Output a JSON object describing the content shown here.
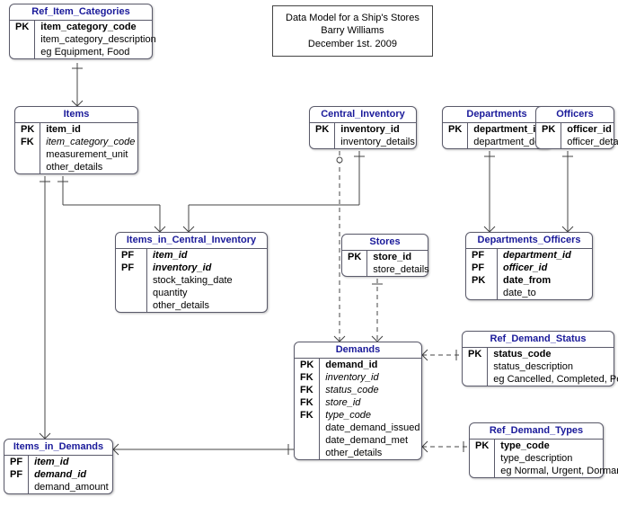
{
  "title": {
    "line1": "Data Model for a Ship's Stores",
    "line2": "Barry Williams",
    "line3": "December 1st. 2009"
  },
  "entities": {
    "ref_item_categories": {
      "name": "Ref_Item_Categories",
      "rows": [
        {
          "key": "PK",
          "attr": "item_category_code",
          "cls": "pk"
        },
        {
          "key": "",
          "attr": "item_category_description",
          "cls": ""
        },
        {
          "key": "",
          "attr": "eg Equipment, Food",
          "cls": "note"
        }
      ]
    },
    "items": {
      "name": "Items",
      "rows": [
        {
          "key": "PK",
          "attr": "item_id",
          "cls": "pk"
        },
        {
          "key": "FK",
          "attr": "item_category_code",
          "cls": "fk"
        },
        {
          "key": "",
          "attr": "measurement_unit",
          "cls": ""
        },
        {
          "key": "",
          "attr": "other_details",
          "cls": ""
        }
      ]
    },
    "central_inventory": {
      "name": "Central_Inventory",
      "rows": [
        {
          "key": "PK",
          "attr": "inventory_id",
          "cls": "pk"
        },
        {
          "key": "",
          "attr": "inventory_details",
          "cls": ""
        }
      ]
    },
    "departments": {
      "name": "Departments",
      "rows": [
        {
          "key": "PK",
          "attr": "department_id",
          "cls": "pk"
        },
        {
          "key": "",
          "attr": "department_details",
          "cls": ""
        }
      ]
    },
    "officers": {
      "name": "Officers",
      "rows": [
        {
          "key": "PK",
          "attr": "officer_id",
          "cls": "pk"
        },
        {
          "key": "",
          "attr": "officer_details",
          "cls": ""
        }
      ]
    },
    "items_in_central_inventory": {
      "name": "Items_in_Central_Inventory",
      "rows": [
        {
          "key": "PF",
          "attr": "item_id",
          "cls": "pf"
        },
        {
          "key": "PF",
          "attr": "inventory_id",
          "cls": "pf"
        },
        {
          "key": "",
          "attr": "stock_taking_date",
          "cls": ""
        },
        {
          "key": "",
          "attr": "quantity",
          "cls": ""
        },
        {
          "key": "",
          "attr": "other_details",
          "cls": ""
        }
      ]
    },
    "stores": {
      "name": "Stores",
      "rows": [
        {
          "key": "PK",
          "attr": "store_id",
          "cls": "pk"
        },
        {
          "key": "",
          "attr": "store_details",
          "cls": ""
        }
      ]
    },
    "departments_officers": {
      "name": "Departments_Officers",
      "rows": [
        {
          "key": "PF",
          "attr": "department_id",
          "cls": "pf"
        },
        {
          "key": "PF",
          "attr": "officer_id",
          "cls": "pf"
        },
        {
          "key": "PK",
          "attr": "date_from",
          "cls": "pk"
        },
        {
          "key": "",
          "attr": "date_to",
          "cls": ""
        }
      ]
    },
    "demands": {
      "name": "Demands",
      "rows": [
        {
          "key": "PK",
          "attr": "demand_id",
          "cls": "pk"
        },
        {
          "key": "FK",
          "attr": "inventory_id",
          "cls": "fk"
        },
        {
          "key": "FK",
          "attr": "status_code",
          "cls": "fk"
        },
        {
          "key": "FK",
          "attr": "store_id",
          "cls": "fk"
        },
        {
          "key": "FK",
          "attr": "type_code",
          "cls": "fk"
        },
        {
          "key": "",
          "attr": "date_demand_issued",
          "cls": ""
        },
        {
          "key": "",
          "attr": "date_demand_met",
          "cls": ""
        },
        {
          "key": "",
          "attr": "other_details",
          "cls": ""
        }
      ]
    },
    "ref_demand_status": {
      "name": "Ref_Demand_Status",
      "rows": [
        {
          "key": "PK",
          "attr": "status_code",
          "cls": "pk"
        },
        {
          "key": "",
          "attr": "status_description",
          "cls": ""
        },
        {
          "key": "",
          "attr": "eg Cancelled, Completed, Pending",
          "cls": "note"
        }
      ]
    },
    "ref_demand_types": {
      "name": "Ref_Demand_Types",
      "rows": [
        {
          "key": "PK",
          "attr": "type_code",
          "cls": "pk"
        },
        {
          "key": "",
          "attr": "type_description",
          "cls": ""
        },
        {
          "key": "",
          "attr": "eg Normal, Urgent, Dormant",
          "cls": "note"
        }
      ]
    },
    "items_in_demands": {
      "name": "Items_in_Demands",
      "rows": [
        {
          "key": "PF",
          "attr": "item_id",
          "cls": "pf"
        },
        {
          "key": "PF",
          "attr": "demand_id",
          "cls": "pf"
        },
        {
          "key": "",
          "attr": "demand_amount",
          "cls": ""
        }
      ]
    }
  }
}
